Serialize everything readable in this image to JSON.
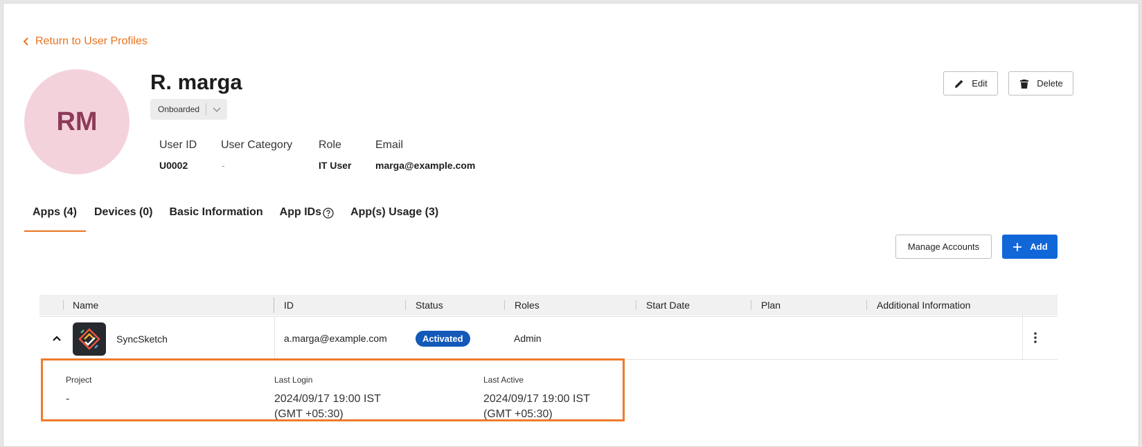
{
  "nav": {
    "back_label": "Return to User Profiles"
  },
  "profile": {
    "initials": "RM",
    "name": "R. marga",
    "status": "Onboarded",
    "fields": [
      {
        "label": "User ID",
        "value": "U0002"
      },
      {
        "label": "User Category",
        "value": "-"
      },
      {
        "label": "Role",
        "value": "IT User"
      },
      {
        "label": "Email",
        "value": "marga@example.com"
      }
    ]
  },
  "actions": {
    "edit_label": "Edit",
    "delete_label": "Delete"
  },
  "tabs": [
    {
      "label": "Apps (4)",
      "active": true
    },
    {
      "label": "Devices (0)"
    },
    {
      "label": "Basic Information"
    },
    {
      "label": "App IDs"
    },
    {
      "label": "App(s) Usage (3)"
    }
  ],
  "table_actions": {
    "manage_label": "Manage Accounts",
    "add_label": "Add"
  },
  "table": {
    "columns": [
      "Name",
      "ID",
      "Status",
      "Roles",
      "Start Date",
      "Plan",
      "Additional Information"
    ],
    "rows": [
      {
        "name": "SyncSketch",
        "id": "a.marga@example.com",
        "status": "Activated",
        "roles": "Admin",
        "start_date": "",
        "plan": "",
        "additional": "",
        "expanded": true,
        "details": [
          {
            "label": "Project",
            "value": "-"
          },
          {
            "label": "Last Login",
            "value": "2024/09/17 19:00 IST\n(GMT +05:30)"
          },
          {
            "label": "Last Active",
            "value": "2024/09/17 19:00 IST\n(GMT +05:30)"
          }
        ]
      }
    ]
  },
  "colors": {
    "accent": "#e8721e",
    "primary": "#1167d8",
    "badge": "#1359b8",
    "avatar_bg": "#f4d2dc",
    "avatar_text": "#8c3b58",
    "highlight_border": "#ef7a2a"
  },
  "icons": {
    "back": "chevron-left-icon",
    "edit": "pencil-icon",
    "delete": "trash-icon",
    "add": "plus-icon",
    "dropdown": "chevron-down-icon",
    "help": "question-circle-icon",
    "collapse": "chevron-up-icon",
    "more": "more-vertical-icon",
    "app": "syncsketch-logo-icon"
  }
}
